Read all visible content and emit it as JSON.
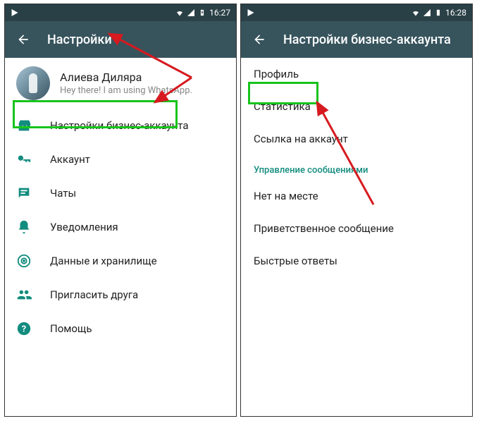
{
  "left": {
    "statusbar": {
      "time": "16:27"
    },
    "toolbar": {
      "title": "Настройки"
    },
    "profile": {
      "name": "Алиева Диляра",
      "status": "Hey there! I am using WhatsApp."
    },
    "items": [
      {
        "icon": "storefront-icon",
        "label": "Настройки бизнес-аккаунта"
      },
      {
        "icon": "key-icon",
        "label": "Аккаунт"
      },
      {
        "icon": "chat-icon",
        "label": "Чаты"
      },
      {
        "icon": "bell-icon",
        "label": "Уведомления"
      },
      {
        "icon": "data-icon",
        "label": "Данные и хранилище"
      },
      {
        "icon": "invite-icon",
        "label": "Пригласить друга"
      },
      {
        "icon": "help-icon",
        "label": "Помощь"
      }
    ]
  },
  "right": {
    "statusbar": {
      "time": "16:28"
    },
    "toolbar": {
      "title": "Настройки бизнес-аккаунта"
    },
    "items": [
      {
        "label": "Профиль"
      },
      {
        "label": "Статистика"
      },
      {
        "label": "Ссылка на аккаунт"
      }
    ],
    "section_header": "Управление сообщениями",
    "items2": [
      {
        "label": "Нет на месте"
      },
      {
        "label": "Приветственное сообщение"
      },
      {
        "label": "Быстрые ответы"
      }
    ]
  },
  "colors": {
    "accent": "#128c7e",
    "header": "#37545d",
    "highlight": "#18c41c",
    "arrow": "#d61a1f"
  }
}
